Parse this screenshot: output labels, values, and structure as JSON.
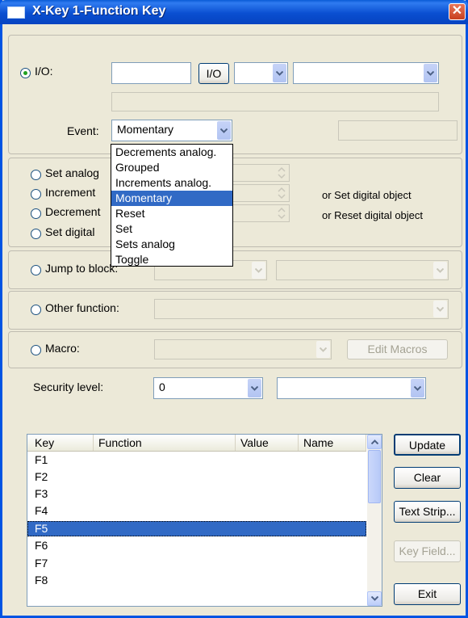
{
  "window": {
    "title": "X-Key 1-Function Key",
    "close_glyph": "✕"
  },
  "io": {
    "label": "I/O:",
    "value": "",
    "button_label": "I/O",
    "combo1": "",
    "combo2": "",
    "description": "",
    "event_label": "Event:",
    "event_value": "Momentary",
    "event_side_field": ""
  },
  "event_dropdown": {
    "options": [
      "Decrements analog.",
      "Grouped",
      "Increments analog.",
      "Momentary",
      "Reset",
      "Set",
      "Sets analog",
      "Toggle"
    ],
    "selected": "Momentary"
  },
  "analog": {
    "set_label": "Set analog",
    "increment_label": "Increment",
    "decrement_label": "Decrement",
    "set_digital_label": "Set digital",
    "or_set_digital": "or Set digital object",
    "or_reset_digital": "or Reset digital object"
  },
  "jump": {
    "label": "Jump to block:"
  },
  "other": {
    "label": "Other function:"
  },
  "macro": {
    "label": "Macro:",
    "edit_button": "Edit Macros"
  },
  "security": {
    "label": "Security level:",
    "value": "0",
    "combo2": ""
  },
  "keys_table": {
    "columns": [
      "Key",
      "Function",
      "Value",
      "Name"
    ],
    "rows": [
      "F1",
      "F2",
      "F3",
      "F4",
      "F5",
      "F6",
      "F7",
      "F8"
    ],
    "selected": "F5"
  },
  "buttons": {
    "update": "Update",
    "clear": "Clear",
    "text_strip": "Text Strip...",
    "key_field": "Key Field...",
    "exit": "Exit"
  },
  "colors": {
    "title_bar": "#0a4fd1",
    "selection": "#316ac5",
    "dialog_bg": "#ece9d8"
  }
}
